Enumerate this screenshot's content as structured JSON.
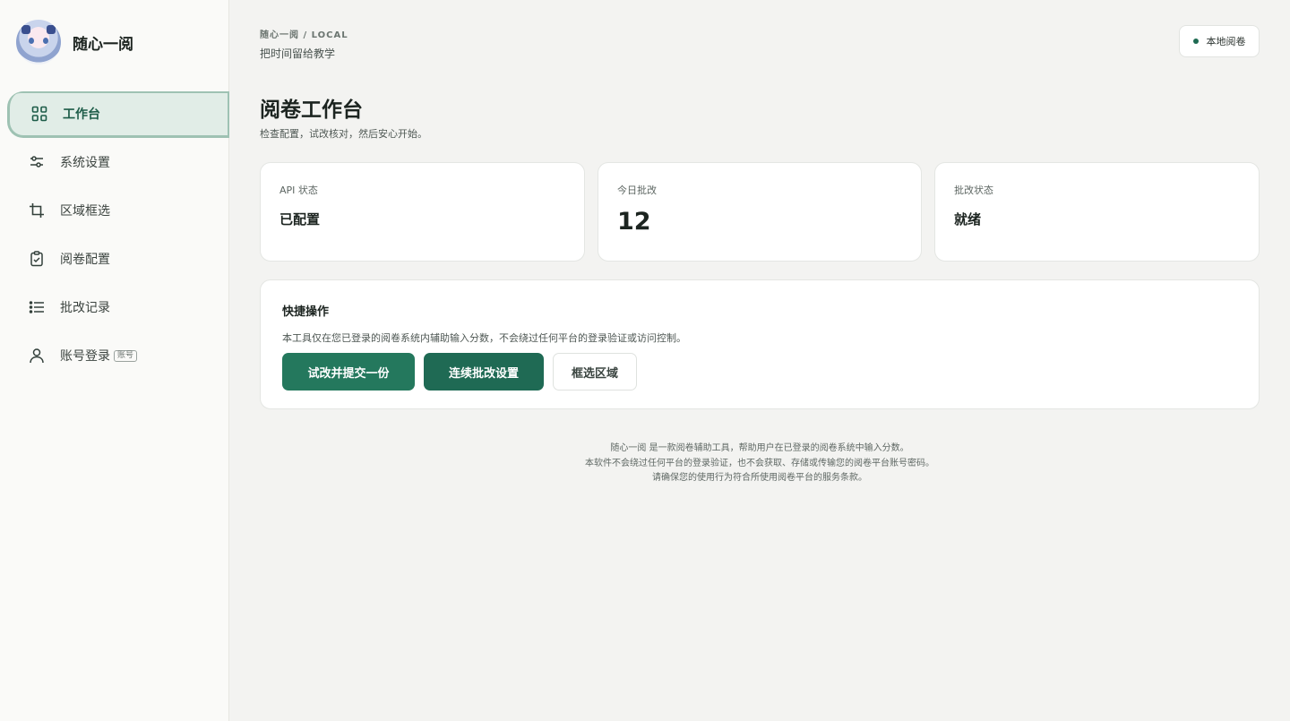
{
  "brand": {
    "name": "随心一阅"
  },
  "nav": [
    {
      "label": "工作台",
      "icon": "grid-icon",
      "active": true
    },
    {
      "label": "系统设置",
      "icon": "sliders-icon"
    },
    {
      "label": "区域框选",
      "icon": "crop-icon"
    },
    {
      "label": "阅卷配置",
      "icon": "clipboard-check-icon"
    },
    {
      "label": "批改记录",
      "icon": "list-icon"
    },
    {
      "label": "账号登录",
      "icon": "user-icon",
      "tag": "账号"
    }
  ],
  "header": {
    "breadcrumb": "随心一阅 / LOCAL",
    "subtitle": "把时间留给教学",
    "mode_label": "本地阅卷"
  },
  "page": {
    "title": "阅卷工作台",
    "description": "检查配置，试改核对，然后安心开始。"
  },
  "stats": [
    {
      "label": "API 状态",
      "value": "已配置"
    },
    {
      "label": "今日批改",
      "value": "12"
    },
    {
      "label": "批改状态",
      "value": "就绪"
    }
  ],
  "quick": {
    "title": "快捷操作",
    "description": "本工具仅在您已登录的阅卷系统内辅助输入分数，不会绕过任何平台的登录验证或访问控制。",
    "buttons": [
      "试改并提交一份",
      "连续批改设置",
      "框选区域"
    ]
  },
  "footer": {
    "line1": "随心一阅 是一款阅卷辅助工具，帮助用户在已登录的阅卷系统中输入分数。",
    "line2": "本软件不会绕过任何平台的登录验证，也不会获取、存储或传输您的阅卷平台账号密码。",
    "line3": "请确保您的使用行为符合所使用阅卷平台的服务条款。"
  },
  "colors": {
    "accent": "#24785d",
    "accent_dark": "#1f6a54",
    "active_bg": "#e1ede7",
    "background": "#f3f3f1"
  }
}
